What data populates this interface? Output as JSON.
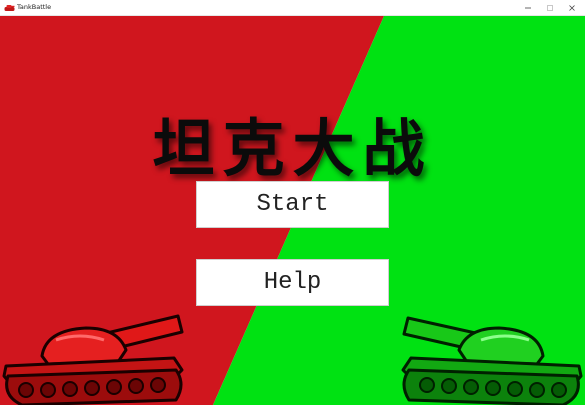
{
  "window": {
    "title": "TankBattle",
    "controls": [
      "minimize",
      "maximize",
      "close"
    ]
  },
  "game": {
    "title": "坦克大战",
    "buttons": {
      "start": "Start",
      "help": "Help"
    },
    "colors": {
      "left_bg": "#d0161e",
      "right_bg": "#00e212",
      "red_tank": "#e01010",
      "green_tank": "#14c814"
    }
  }
}
